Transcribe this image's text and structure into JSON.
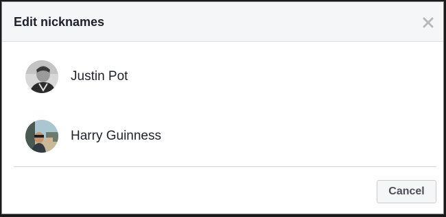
{
  "dialog": {
    "title": "Edit nicknames",
    "close_icon": "close-icon",
    "cancel_label": "Cancel"
  },
  "people": [
    {
      "name": "Justin Pot",
      "avatar": "user-avatar-photo"
    },
    {
      "name": "Harry Guinness",
      "avatar": "user-avatar-photo"
    }
  ],
  "colors": {
    "header_bg": "#f5f6f7",
    "text": "#1d2129",
    "close_icon": "#b5b8bd",
    "button_text": "#4b4f56"
  }
}
